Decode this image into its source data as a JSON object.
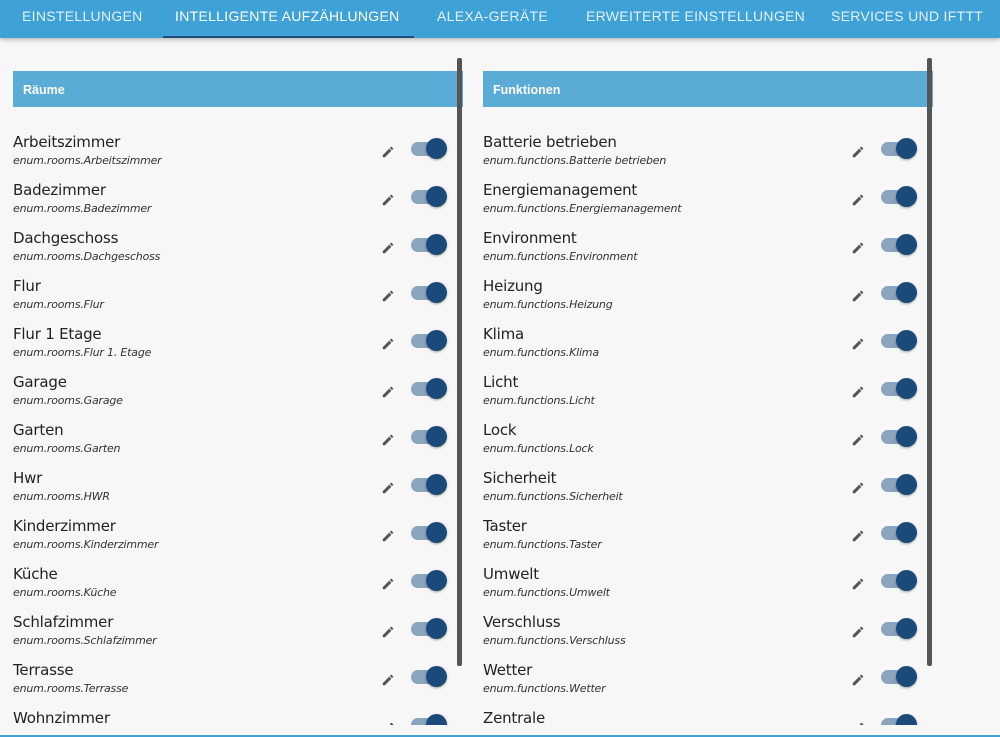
{
  "tabs": [
    {
      "label": "EINSTELLUNGEN",
      "active": false
    },
    {
      "label": "INTELLIGENTE AUFZÄHLUNGEN",
      "active": true
    },
    {
      "label": "ALEXA-GERÄTE",
      "active": false
    },
    {
      "label": "ERWEITERTE EINSTELLUNGEN",
      "active": false
    },
    {
      "label": "SERVICES UND IFTTT",
      "active": false
    }
  ],
  "rooms": {
    "header": "Räume",
    "items": [
      {
        "title": "Arbeitszimmer",
        "id": "enum.rooms.Arbeitszimmer",
        "enabled": true
      },
      {
        "title": "Badezimmer",
        "id": "enum.rooms.Badezimmer",
        "enabled": true
      },
      {
        "title": "Dachgeschoss",
        "id": "enum.rooms.Dachgeschoss",
        "enabled": true
      },
      {
        "title": "Flur",
        "id": "enum.rooms.Flur",
        "enabled": true
      },
      {
        "title": "Flur 1 Etage",
        "id": "enum.rooms.Flur 1. Etage",
        "enabled": true
      },
      {
        "title": "Garage",
        "id": "enum.rooms.Garage",
        "enabled": true
      },
      {
        "title": "Garten",
        "id": "enum.rooms.Garten",
        "enabled": true
      },
      {
        "title": "Hwr",
        "id": "enum.rooms.HWR",
        "enabled": true
      },
      {
        "title": "Kinderzimmer",
        "id": "enum.rooms.Kinderzimmer",
        "enabled": true
      },
      {
        "title": "Küche",
        "id": "enum.rooms.Küche",
        "enabled": true
      },
      {
        "title": "Schlafzimmer",
        "id": "enum.rooms.Schlafzimmer",
        "enabled": true
      },
      {
        "title": "Terrasse",
        "id": "enum.rooms.Terrasse",
        "enabled": true
      },
      {
        "title": "Wohnzimmer",
        "id": "",
        "enabled": true
      }
    ]
  },
  "functions": {
    "header": "Funktionen",
    "items": [
      {
        "title": "Batterie betrieben",
        "id": "enum.functions.Batterie betrieben",
        "enabled": true
      },
      {
        "title": "Energiemanagement",
        "id": "enum.functions.Energiemanagement",
        "enabled": true
      },
      {
        "title": "Environment",
        "id": "enum.functions.Environment",
        "enabled": true
      },
      {
        "title": "Heizung",
        "id": "enum.functions.Heizung",
        "enabled": true
      },
      {
        "title": "Klima",
        "id": "enum.functions.Klima",
        "enabled": true
      },
      {
        "title": "Licht",
        "id": "enum.functions.Licht",
        "enabled": true
      },
      {
        "title": "Lock",
        "id": "enum.functions.Lock",
        "enabled": true
      },
      {
        "title": "Sicherheit",
        "id": "enum.functions.Sicherheit",
        "enabled": true
      },
      {
        "title": "Taster",
        "id": "enum.functions.Taster",
        "enabled": true
      },
      {
        "title": "Umwelt",
        "id": "enum.functions.Umwelt",
        "enabled": true
      },
      {
        "title": "Verschluss",
        "id": "enum.functions.Verschluss",
        "enabled": true
      },
      {
        "title": "Wetter",
        "id": "enum.functions.Wetter",
        "enabled": true
      },
      {
        "title": "Zentrale",
        "id": "",
        "enabled": true
      }
    ]
  },
  "icons": {
    "edit": "pencil-icon",
    "toggle": "toggle-switch"
  },
  "colors": {
    "tabbar": "#3ea2d6",
    "panel_header": "#5aacd7",
    "switch_knob": "#1b4a7a",
    "switch_track": "#8aa4bd"
  }
}
